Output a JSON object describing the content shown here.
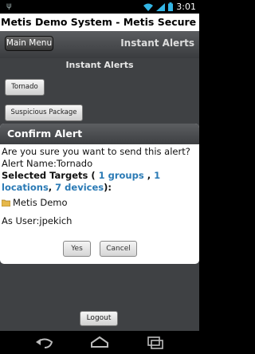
{
  "status_bar": {
    "notification_icon": "android-notification-icon",
    "time": "3:01"
  },
  "page": {
    "title": "Metis Demo System - Metis Secure Solutions"
  },
  "header": {
    "main_menu_label": "Main Menu",
    "title": "Instant Alerts"
  },
  "content": {
    "heading": "Instant Alerts",
    "alert_buttons": [
      "Tornado",
      "Suspicious Package"
    ]
  },
  "dialog": {
    "title": "Confirm Alert",
    "question": "Are you sure you want to send this alert?",
    "alert_name": "Alert Name:Tornado",
    "targets_prefix": "Selected Targets ( ",
    "groups_link": "1 groups",
    "separator1": " , ",
    "locations_link": "1 locations",
    "separator2": ", ",
    "devices_link": "7 devices",
    "targets_suffix": "):",
    "folder_label": "Metis Demo",
    "as_user": "As User:jpekich",
    "yes_label": "Yes",
    "cancel_label": "Cancel"
  },
  "footer": {
    "logout_label": "Logout"
  },
  "colors": {
    "page_bg": "#3f4144",
    "link": "#2a7ab5",
    "dialog_header": "#4a4c4f"
  }
}
